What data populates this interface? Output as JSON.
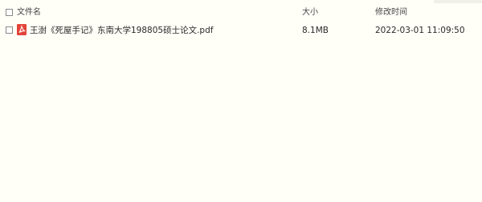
{
  "columns": {
    "name": "文件名",
    "size": "大小",
    "modified": "修改时间"
  },
  "files": [
    {
      "icon": "pdf-icon",
      "name": "王澍《死屋手记》东南大学198805硕士论文.pdf",
      "size": "8.1MB",
      "modified": "2022-03-01 11:09:50"
    }
  ],
  "colors": {
    "background": "#fffef7",
    "pdf_icon": "#e2443a"
  }
}
